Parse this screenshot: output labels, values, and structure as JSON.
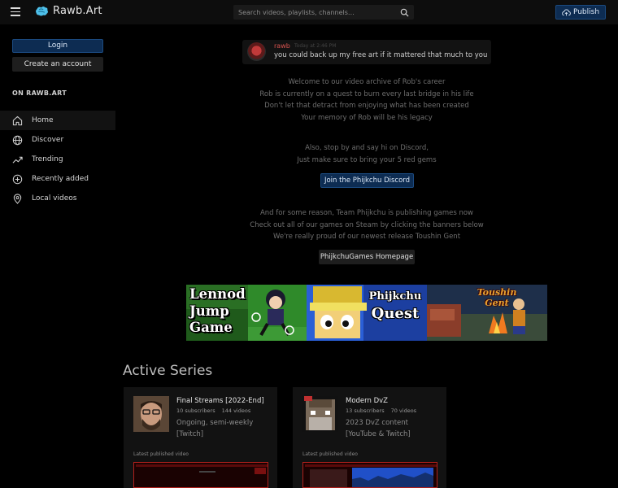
{
  "header": {
    "brand": "Rawb.Art",
    "search_placeholder": "Search videos, playlists, channels…",
    "publish_label": "Publish"
  },
  "sidebar": {
    "login_label": "Login",
    "create_account_label": "Create an account",
    "section_heading": "ON RAWB.ART",
    "items": [
      {
        "label": "Home",
        "icon": "home-icon",
        "active": true
      },
      {
        "label": "Discover",
        "icon": "globe-icon"
      },
      {
        "label": "Trending",
        "icon": "trending-icon"
      },
      {
        "label": "Recently added",
        "icon": "plus-circle-icon"
      },
      {
        "label": "Local videos",
        "icon": "location-pin-icon"
      }
    ]
  },
  "comment": {
    "user": "rawb",
    "time": "Today at 2:46 PM",
    "text": "you could back up my free art if it mattered that much to you"
  },
  "intro": {
    "lines": [
      "Welcome to our video archive of Rob's career",
      "Rob is currently on a quest to burn every last bridge in his life",
      "Don't let that detract from enjoying what has been created",
      "Your memory of Rob will be his legacy"
    ]
  },
  "discord": {
    "lines": [
      "Also, stop by and say hi on Discord,",
      "Just make sure to bring your 5 red gems"
    ],
    "button_label": "Join the Phijkchu Discord"
  },
  "games": {
    "lines": [
      "And for some reason, Team Phijkchu is publishing games now",
      "Check out all of our games on Steam by clicking the banners below",
      "We're really proud of our newest release Toushin Gent"
    ],
    "button_label": "PhijkchuGames Homepage",
    "banners": [
      {
        "lines": [
          "Lennod",
          "Jump",
          "Game"
        ]
      },
      {
        "lines": [
          "Phijkchu",
          "Quest"
        ]
      },
      {
        "lines": [
          "Toushin Gent"
        ]
      }
    ]
  },
  "active_series": {
    "title": "Active Series",
    "latest_label": "Latest published video",
    "cards": [
      {
        "name": "Final Streams [2022-End]",
        "subscribers": "10 subscribers",
        "videos": "144 videos",
        "desc": [
          "Ongoing, semi-weekly",
          "[Twitch]"
        ]
      },
      {
        "name": "Modern DvZ",
        "subscribers": "13 subscribers",
        "videos": "70 videos",
        "desc": [
          "2023 DvZ content",
          "[YouTube & Twitch]"
        ]
      }
    ]
  },
  "colors": {
    "accent_blue": "#0d2c52",
    "comment_username": "#d9534f",
    "page_background": "#000000"
  }
}
